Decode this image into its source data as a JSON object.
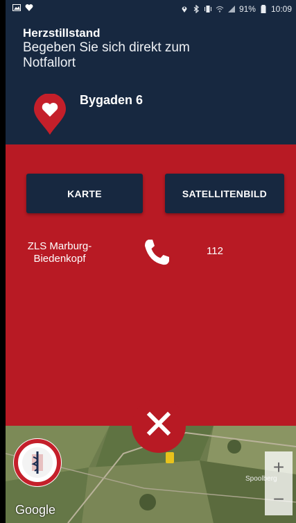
{
  "status_bar": {
    "battery": "91%",
    "time": "10:09",
    "left_icons": [
      "image-icon",
      "heart-icon"
    ],
    "right_icons": [
      "location-icon",
      "bluetooth-icon",
      "vibrate-icon",
      "wifi-icon",
      "signal-icon",
      "battery-icon"
    ]
  },
  "alert": {
    "title": "Herzstillstand",
    "instruction": "Begeben Sie sich direkt zum Notfallort",
    "address": "Bygaden 6"
  },
  "buttons": {
    "map_label": "KARTE",
    "satellite_label": "SATELLITENBILD"
  },
  "contact": {
    "name": "ZLS Marburg-Biedenkopf",
    "number": "112"
  },
  "map": {
    "attribution": "Google",
    "place_label": "Spoolberg",
    "zoom_in": "+",
    "zoom_out": "−"
  },
  "colors": {
    "header_bg": "#172840",
    "panel_red": "#b81a24",
    "button_bg": "#172840"
  }
}
